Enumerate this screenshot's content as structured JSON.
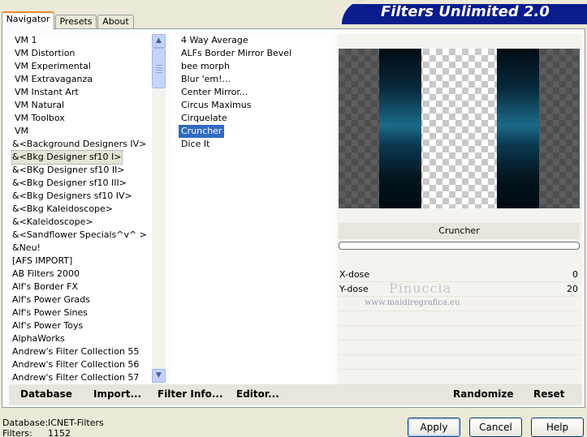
{
  "tabs": [
    {
      "label": "Navigator",
      "active": true
    },
    {
      "label": "Presets",
      "active": false
    },
    {
      "label": "About",
      "active": false
    }
  ],
  "banner": {
    "title": "Filters Unlimited 2.0"
  },
  "categories": [
    "VM 1",
    "VM Distortion",
    "VM Experimental",
    "VM Extravaganza",
    "VM Instant Art",
    "VM Natural",
    "VM Toolbox",
    "VM",
    "&<Background Designers IV>",
    "&<Bkg Designer sf10 I>",
    "&<BKg Designer sf10 II>",
    "&<Bkg Designer sf10 III>",
    "&<Bkg Designers sf10 IV>",
    "&<Bkg Kaleidoscope>",
    "&<Kaleidoscope>",
    "&<Sandflower Specials^v^ >",
    "&Neu!",
    "[AFS IMPORT]",
    "AB Filters 2000",
    "Alf's Border FX",
    "Alf's Power Grads",
    "Alf's Power Sines",
    "Alf's Power Toys",
    "AlphaWorks",
    "Andrew's Filter Collection 55",
    "Andrew's Filter Collection 56",
    "Andrew's Filter Collection 57"
  ],
  "selected_category": "&<Bkg Designer sf10 I>",
  "filters": [
    "4 Way Average",
    "ALFs Border Mirror Bevel",
    "bee morph",
    "Blur 'em!...",
    "Center Mirror...",
    "Circus Maximus",
    "Cirquelate",
    "Cruncher",
    "Dice It"
  ],
  "selected_filter": "Cruncher",
  "filter_name": "Cruncher",
  "params": [
    {
      "label": "X-dose",
      "value": "0"
    },
    {
      "label": "Y-dose",
      "value": "20"
    }
  ],
  "watermark": {
    "name": "Pinuccia",
    "url": "www.maidiregrafica.eu"
  },
  "bottom_buttons": {
    "database": "Database",
    "import": "Import...",
    "filter_info": "Filter Info...",
    "editor": "Editor...",
    "randomize": "Randomize",
    "reset": "Reset"
  },
  "status": {
    "database_label": "Database:",
    "database_value": "ICNET-Filters",
    "filters_label": "Filters:",
    "filters_value": "1152"
  },
  "dialog_buttons": {
    "apply": "Apply",
    "cancel": "Cancel",
    "help": "Help"
  },
  "colors": {
    "banner": "#0a1c8c",
    "selection": "#316ac5",
    "tab_highlight": "#e68b2c"
  }
}
